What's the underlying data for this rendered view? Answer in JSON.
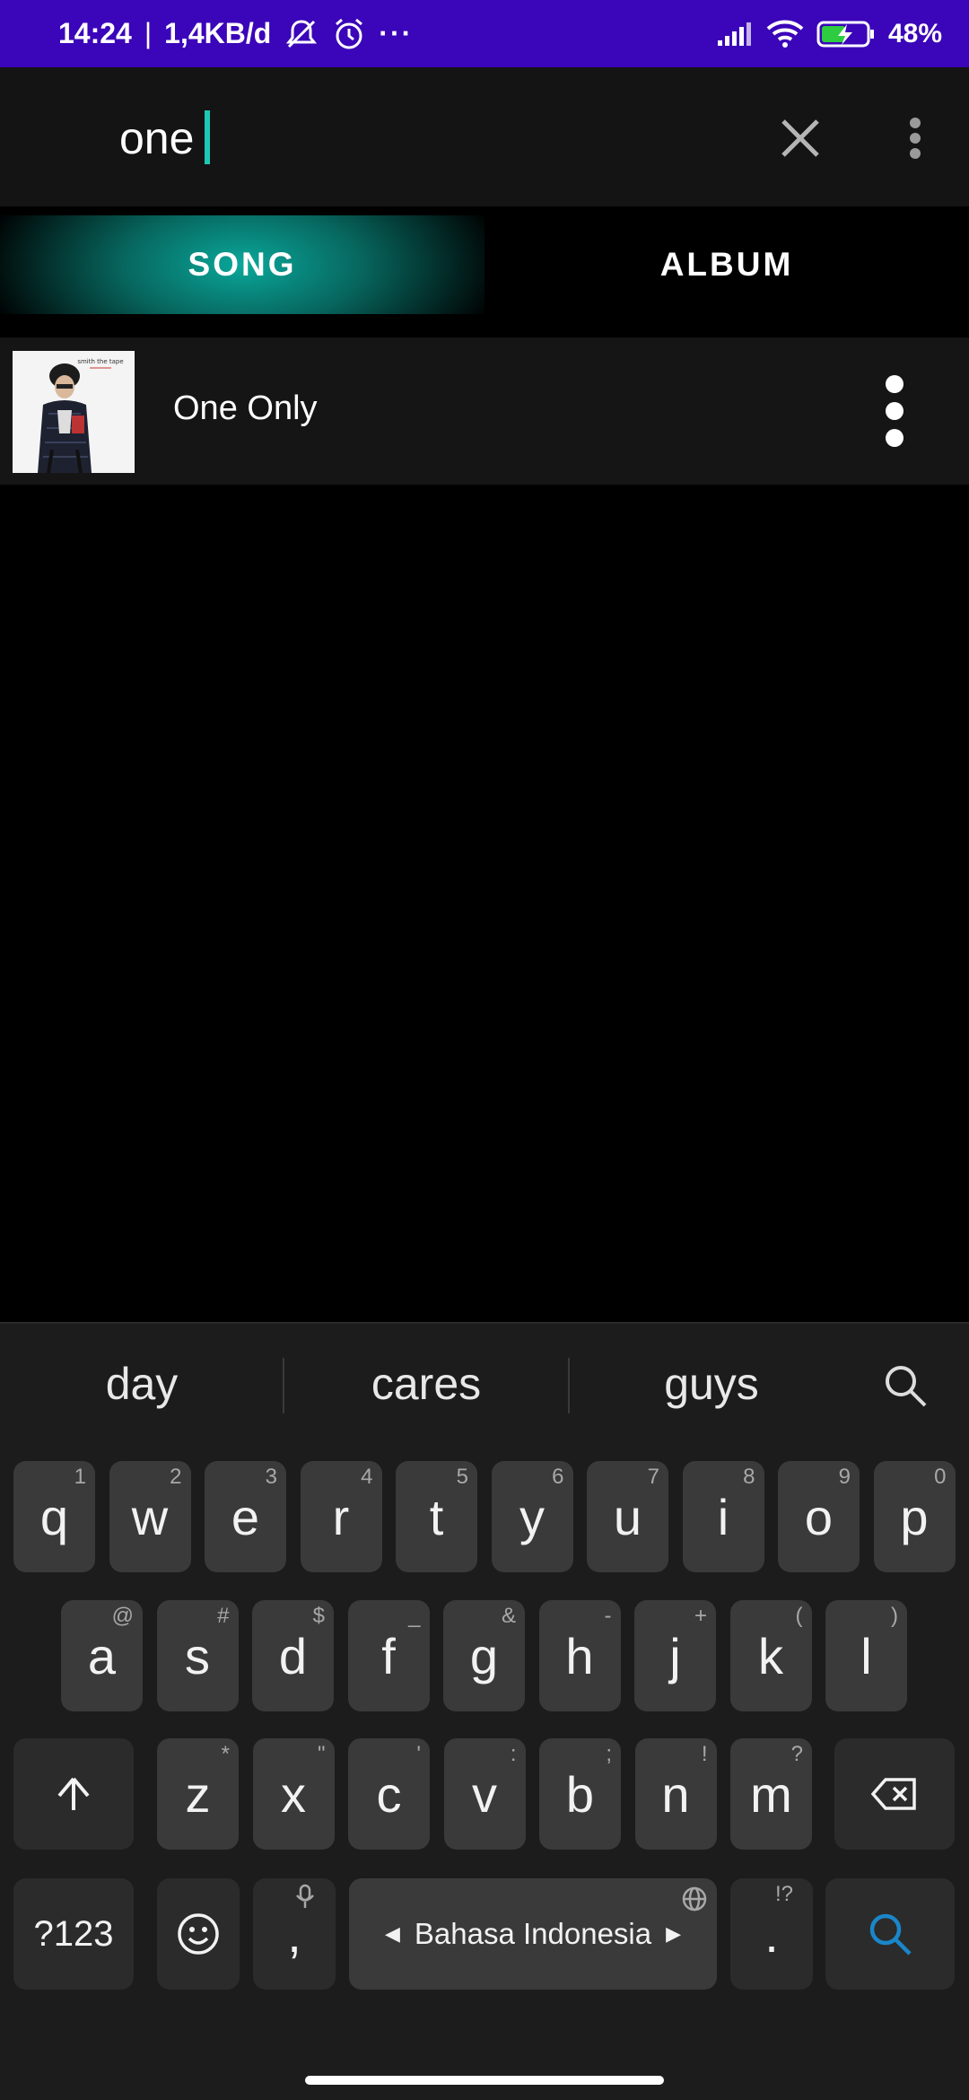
{
  "status_bar": {
    "time": "14:24",
    "separator": "|",
    "data_rate": "1,4KB/d",
    "more": "···",
    "battery": "48%",
    "icons": [
      "silent-bell-off-icon",
      "alarm-icon",
      "signal-icon",
      "wifi-icon",
      "battery-charging-icon"
    ]
  },
  "search": {
    "query": "one",
    "icons": [
      "close-icon",
      "more-vert-icon"
    ]
  },
  "tabs": [
    {
      "label": "SONG",
      "active": true
    },
    {
      "label": "ALBUM",
      "active": false
    }
  ],
  "songs": [
    {
      "title": "One Only",
      "thumb_caption": "smith the tape",
      "icon": "more-vert-icon"
    }
  ],
  "keyboard": {
    "suggestions": [
      "day",
      "cares",
      "guys"
    ],
    "row1": [
      {
        "k": "q",
        "h": "1"
      },
      {
        "k": "w",
        "h": "2"
      },
      {
        "k": "e",
        "h": "3"
      },
      {
        "k": "r",
        "h": "4"
      },
      {
        "k": "t",
        "h": "5"
      },
      {
        "k": "y",
        "h": "6"
      },
      {
        "k": "u",
        "h": "7"
      },
      {
        "k": "i",
        "h": "8"
      },
      {
        "k": "o",
        "h": "9"
      },
      {
        "k": "p",
        "h": "0"
      }
    ],
    "row2": [
      {
        "k": "a",
        "h": "@"
      },
      {
        "k": "s",
        "h": "#"
      },
      {
        "k": "d",
        "h": "$"
      },
      {
        "k": "f",
        "h": "_"
      },
      {
        "k": "g",
        "h": "&"
      },
      {
        "k": "h",
        "h": "-"
      },
      {
        "k": "j",
        "h": "+"
      },
      {
        "k": "k",
        "h": "("
      },
      {
        "k": "l",
        "h": ")"
      }
    ],
    "row3": [
      {
        "k": "z",
        "h": "*"
      },
      {
        "k": "x",
        "h": "\""
      },
      {
        "k": "c",
        "h": "'"
      },
      {
        "k": "v",
        "h": ":"
      },
      {
        "k": "b",
        "h": ";"
      },
      {
        "k": "n",
        "h": "!"
      },
      {
        "k": "m",
        "h": "?"
      }
    ],
    "symbols_label": "?123",
    "comma": ",",
    "space_label": "Bahasa Indonesia",
    "period": ".",
    "period_hint": "!?",
    "accent_color": "#1a86c9"
  }
}
